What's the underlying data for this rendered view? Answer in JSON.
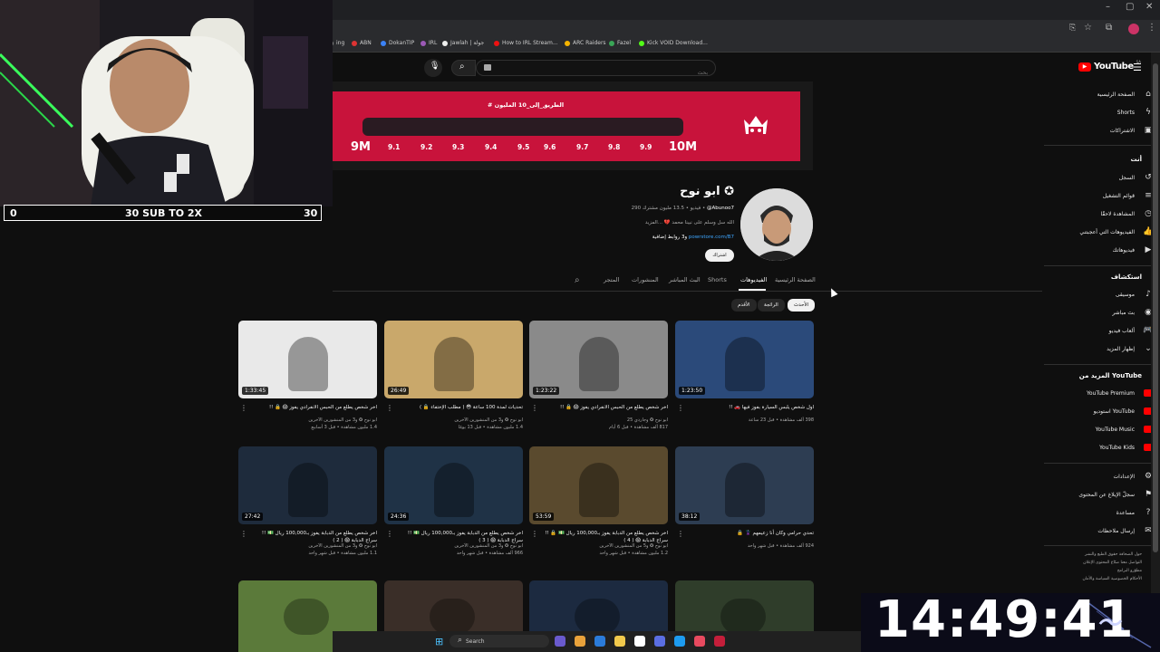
{
  "overlay": {
    "left_count": "0",
    "goal_text": "30 SUB TO 2X",
    "right_count": "30",
    "clock": "14:49:41"
  },
  "bookmarks": [
    {
      "label": "ing",
      "color": "#888888"
    },
    {
      "label": "ABN",
      "color": "#d33"
    },
    {
      "label": "DokanTIP",
      "color": "#3b82f6"
    },
    {
      "label": "IRL",
      "color": "#9b59b6"
    },
    {
      "label": "Jawlah | جولة",
      "color": "#eee"
    },
    {
      "label": "How to IRL Stream...",
      "color": "#e11"
    },
    {
      "label": "ARC Raiders",
      "color": "#f5b400"
    },
    {
      "label": "Fazel",
      "color": "#3aa657"
    },
    {
      "label": "Kick VOID Download...",
      "color": "#53fc18"
    }
  ],
  "search": {
    "placeholder": "بحث"
  },
  "sidebar": {
    "logo": "YouTube",
    "logo_sup": "SA",
    "main": [
      {
        "label": "الصفحة الرئيسية",
        "icon": "home-icon"
      },
      {
        "label": "Shorts",
        "icon": "shorts-icon"
      },
      {
        "label": "الاشتراكات",
        "icon": "subscriptions-icon"
      }
    ],
    "you_header": "أنت",
    "you": [
      {
        "label": "السجل",
        "icon": "history-icon"
      },
      {
        "label": "قوائم التشغيل",
        "icon": "playlist-icon"
      },
      {
        "label": "المشاهدة لاحقًا",
        "icon": "clock-icon"
      },
      {
        "label": "الفيديوهات التي أعجبتني",
        "icon": "like-icon"
      },
      {
        "label": "فيديوهاتك",
        "icon": "video-icon"
      }
    ],
    "explore_header": "استكشاف",
    "explore": [
      {
        "label": "موسيقى",
        "icon": "music-icon"
      },
      {
        "label": "بث مباشر",
        "icon": "live-icon"
      },
      {
        "label": "ألعاب فيديو",
        "icon": "gaming-icon"
      },
      {
        "label": "إظهار المزيد",
        "icon": "chevron-down-icon"
      }
    ],
    "more_header": "المزيد من YouTube",
    "more": [
      {
        "label": "YouTube Premium"
      },
      {
        "label": "استوديو YouTube"
      },
      {
        "label": "YouTube Music"
      },
      {
        "label": "YouTube Kids"
      }
    ],
    "settings": [
      {
        "label": "الإعدادات",
        "icon": "gear-icon"
      },
      {
        "label": "سجلّ الإبلاغ عن المحتوى",
        "icon": "flag-icon"
      },
      {
        "label": "مساعدة",
        "icon": "help-icon"
      },
      {
        "label": "إرسال ملاحظات",
        "icon": "feedback-icon"
      }
    ],
    "footer1": "حول  الصحافة  حقوق الطبع والنشر",
    "footer2": "التواصل معنا  صنّاع المحتوى  الإعلان",
    "footer3": "مطوّرو البرامج",
    "footer4": "الأحكام  الخصوصية  السياسة والأمان"
  },
  "banner": {
    "title": "# الطريق_إلى_10 المليون",
    "ticks": [
      "9.1",
      "9.2",
      "9.3",
      "9.4",
      "9.5",
      "9.6",
      "9.7",
      "9.8",
      "9.9"
    ],
    "start": "9M",
    "end": "10M",
    "progress": 0.0
  },
  "channel": {
    "name": "ابو نوح ✪",
    "handle": "@Abunoo7",
    "subs": "13.5 مليون مشترك",
    "videos": "290 فيديو",
    "desc": "الله سل وسلم على نبينا محمد 💔 ...المزيد",
    "link": "powrstore.com/B7",
    "link_more": "و3 روابط إضافية",
    "subscribe": "اشتراك"
  },
  "tabs": [
    {
      "label": "الصفحة الرئيسية",
      "active": false
    },
    {
      "label": "الفيديوهات",
      "active": true
    },
    {
      "label": "Shorts",
      "active": false
    },
    {
      "label": "البث المباشر",
      "active": false
    },
    {
      "label": "المنشورات",
      "active": false
    },
    {
      "label": "المتجر",
      "active": false
    }
  ],
  "chips": [
    {
      "label": "الأحدث",
      "selected": true
    },
    {
      "label": "الرائجة",
      "selected": false
    },
    {
      "label": "الأقدم",
      "selected": false
    }
  ],
  "videos": [
    {
      "duration": "1:23:50",
      "title": "اول شخص يلبس السيارة بفوز فيها 🚗 !!",
      "meta1": "398 ألف مشاهدة • قبل 23 ساعة",
      "meta2": "",
      "color": "#2b4a7a"
    },
    {
      "duration": "1:23:22",
      "title": "اخر شخص يطلع من الحبس الانفرادي يفوز 😱 🔒 !!",
      "meta1": "ابو نوح ✪ وجاردي 25",
      "meta2": "817 ألف مشاهدة • قبل 6 أيام",
      "color": "#8a8a8a"
    },
    {
      "duration": "26:49",
      "title": "تحديات لمدة 100 ساعة 😳 ( مطلب الإختفاء 🔒 )",
      "meta1": "ابو نوح ✪ و3 من المنشورين الآخرين",
      "meta2": "1.4 مليون مشاهدة • قبل 13 يومًا",
      "color": "#c9a86b"
    },
    {
      "duration": "1:33:45",
      "title": "اخر شخص يطلع من الحبس الانفرادي يفوز 😱 🔒 !!",
      "meta1": "ابو نوح ✪ و3 من المنشورين الآخرين",
      "meta2": "1.4 مليون مشاهدة • قبل 3 أسابيع",
      "color": "#e9e9e9"
    },
    {
      "duration": "38:12",
      "title": "تحدي حرامي وكان أنا زعيمهم 🦹 🔒",
      "meta1": "924 ألف مشاهدة • قبل شهر واحد",
      "meta2": "",
      "color": "#2d3d52"
    },
    {
      "duration": "53:59",
      "title": "اخر شخص يطلع من الدبابة يفوز بـ100,000 ريال 💵 🔒 !! سراج الدبابة 😱 ( 4 )",
      "meta1": "ابو نوح ✪ و5 من المنشورين الآخرين",
      "meta2": "1.2 مليون مشاهدة • قبل شهر واحد",
      "color": "#5a4a2e"
    },
    {
      "duration": "24:36",
      "title": "اخر شخص يطلع من الدبابة يفوز بـ100,000 ريال 💵 !! سراج الدبابة 😱 ( 3 )",
      "meta1": "ابو نوح ✪ و3 من المنشورين الآخرين",
      "meta2": "966 ألف مشاهدة • قبل شهر واحد",
      "color": "#1f3246"
    },
    {
      "duration": "27:42",
      "title": "اخر شخص يطلع من الدبابة يفوز بـ100,000 ريال 💵 !! سراج الدبابة 😱 ( 2 )",
      "meta1": "ابو نوح ✪ و3 من المنشورين الآخرين",
      "meta2": "1.1 مليون مشاهدة • قبل شهر واحد",
      "color": "#1e2b3c"
    },
    {
      "duration": "",
      "title": "",
      "meta1": "",
      "meta2": "",
      "color": "#2f3d2a"
    },
    {
      "duration": "",
      "title": "",
      "meta1": "",
      "meta2": "",
      "color": "#1c2a40"
    },
    {
      "duration": "",
      "title": "",
      "meta1": "",
      "meta2": "",
      "color": "#3a2e28"
    },
    {
      "duration": "",
      "title": "",
      "meta1": "",
      "meta2": "",
      "color": "#5b7a3a"
    }
  ],
  "taskbar": {
    "search": "Search"
  }
}
